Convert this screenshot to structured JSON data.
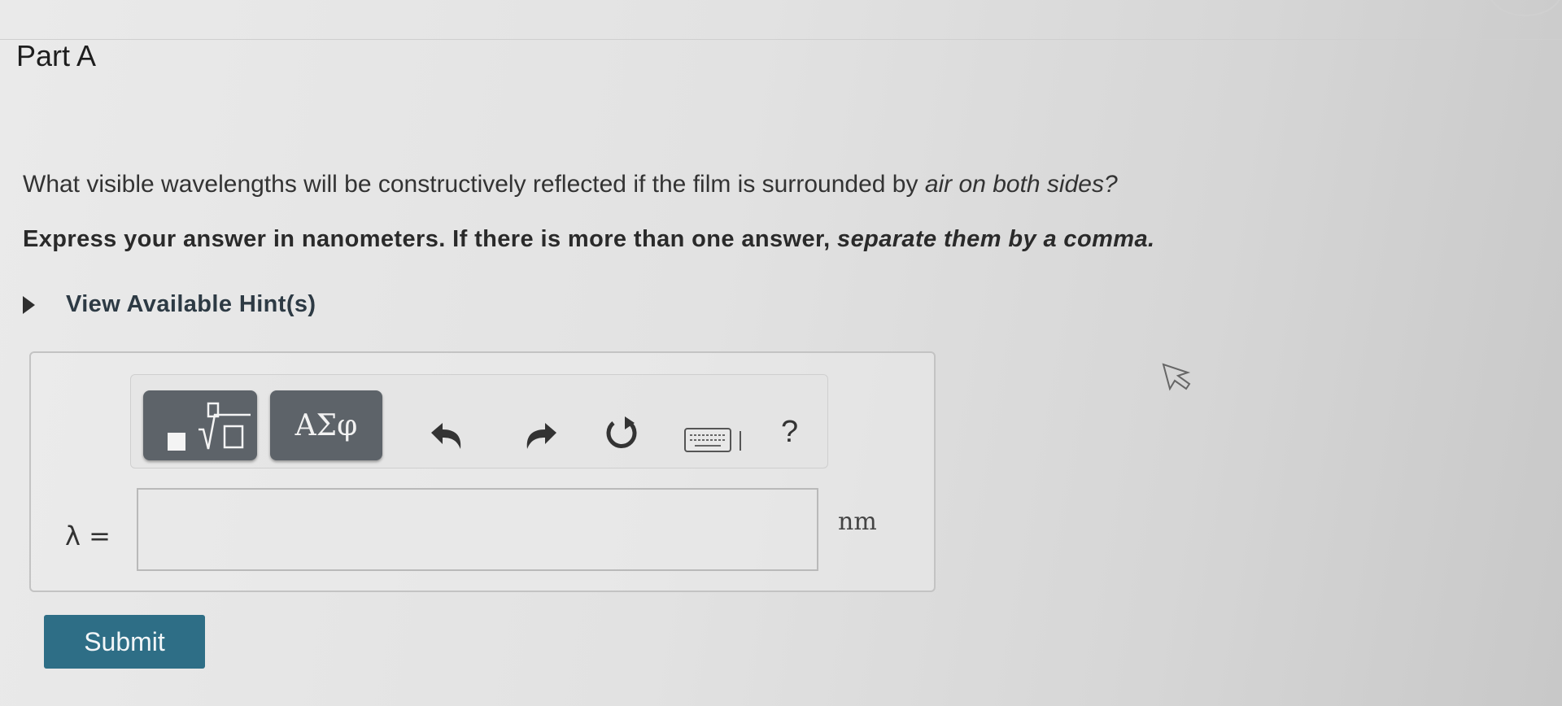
{
  "part": {
    "title": "Part A"
  },
  "question": {
    "text_plain": "What visible wavelengths will be constructively reflected if the film is surrounded by air on both sides?",
    "text_main": "What visible wavelengths will be constructively reflected if the film is surrounded by ",
    "text_italic": "air on both sides?"
  },
  "instructions": {
    "text_main": "Express your answer in nanometers. If there is more than one answer, ",
    "text_italic": "separate them by a comma."
  },
  "hints": {
    "label": "View Available Hint(s)"
  },
  "toolbar": {
    "symbols_label": "ΑΣφ",
    "help_label": "?",
    "icons": [
      "templates-icon",
      "symbols-icon",
      "undo-icon",
      "redo-icon",
      "reset-icon",
      "keyboard-icon",
      "help-icon"
    ]
  },
  "answer": {
    "variable_label": "λ =",
    "value": "",
    "placeholder": "",
    "unit": "nm"
  },
  "submit": {
    "label": "Submit"
  },
  "colors": {
    "submit_bg": "#2e6e86",
    "tool_button_bg": "#5d6369",
    "text": "#2b2b2b"
  }
}
